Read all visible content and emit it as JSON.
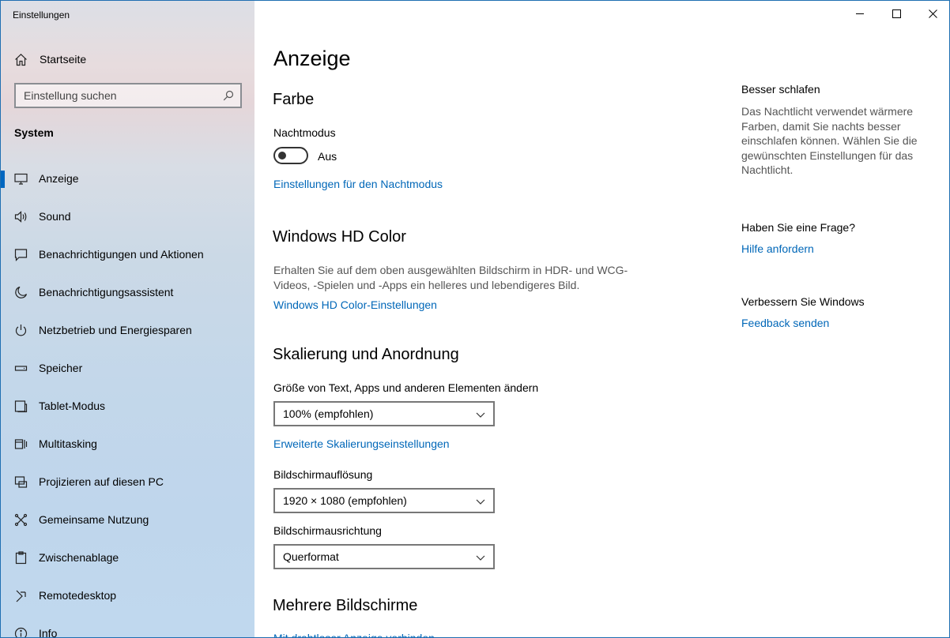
{
  "window": {
    "title": "Einstellungen",
    "controls": {
      "minimize": "minimize-icon",
      "maximize": "maximize-icon",
      "close": "close-icon"
    }
  },
  "sidebar": {
    "home_label": "Startseite",
    "search_placeholder": "Einstellung suchen",
    "section_title": "System",
    "items": [
      {
        "label": "Anzeige",
        "icon": "display-icon",
        "selected": true
      },
      {
        "label": "Sound",
        "icon": "speaker-icon"
      },
      {
        "label": "Benachrichtigungen und Aktionen",
        "icon": "notification-icon"
      },
      {
        "label": "Benachrichtigungsassistent",
        "icon": "moon-icon"
      },
      {
        "label": "Netzbetrieb und Energiesparen",
        "icon": "power-icon"
      },
      {
        "label": "Speicher",
        "icon": "storage-icon"
      },
      {
        "label": "Tablet-Modus",
        "icon": "tablet-icon"
      },
      {
        "label": "Multitasking",
        "icon": "multitasking-icon"
      },
      {
        "label": "Projizieren auf diesen PC",
        "icon": "project-icon"
      },
      {
        "label": "Gemeinsame Nutzung",
        "icon": "share-icon"
      },
      {
        "label": "Zwischenablage",
        "icon": "clipboard-icon"
      },
      {
        "label": "Remotedesktop",
        "icon": "remote-icon"
      },
      {
        "label": "Info",
        "icon": "info-icon"
      }
    ],
    "accent_color": "#0067c0"
  },
  "main": {
    "page_title": "Anzeige",
    "farbe": {
      "heading": "Farbe",
      "nightmode_label": "Nachtmodus",
      "nightmode_state": "Aus",
      "nightmode_on": false,
      "nightmode_link": "Einstellungen für den Nachtmodus"
    },
    "hdcolor": {
      "heading": "Windows HD Color",
      "description": "Erhalten Sie auf dem oben ausgewählten Bildschirm in HDR- und WCG-Videos, -Spielen und -Apps ein helleres und lebendigeres Bild.",
      "link": "Windows HD Color-Einstellungen"
    },
    "scaling": {
      "heading": "Skalierung und Anordnung",
      "size_label": "Größe von Text, Apps und anderen Elementen ändern",
      "size_value": "100% (empfohlen)",
      "advanced_link": "Erweiterte Skalierungseinstellungen",
      "resolution_label": "Bildschirmauflösung",
      "resolution_value": "1920 × 1080 (empfohlen)",
      "orientation_label": "Bildschirmausrichtung",
      "orientation_value": "Querformat"
    },
    "multi": {
      "heading": "Mehrere Bildschirme",
      "link": "Mit drahtloser Anzeige verbinden"
    }
  },
  "right_panel": {
    "sleep_heading": "Besser schlafen",
    "sleep_text": "Das Nachtlicht verwendet wärmere Farben, damit Sie nachts besser einschlafen können. Wählen Sie die gewünschten Einstellungen für das Nachtlicht.",
    "question_heading": "Haben Sie eine Frage?",
    "help_link": "Hilfe anfordern",
    "improve_heading": "Verbessern Sie Windows",
    "feedback_link": "Feedback senden"
  },
  "colors": {
    "link": "#0067b8",
    "selection_bar": "#0067c0"
  }
}
